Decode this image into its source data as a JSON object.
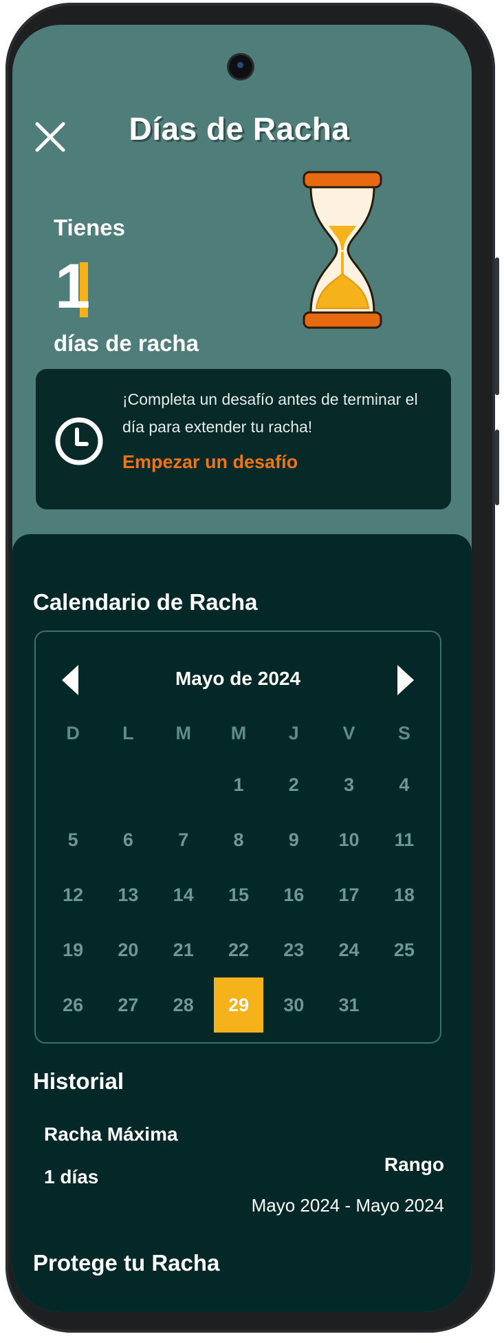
{
  "header": {
    "title": "Días de Racha"
  },
  "streak": {
    "prefix": "Tienes",
    "count": "1",
    "suffix": "días de racha"
  },
  "info_card": {
    "message": "¡Completa un desafío antes de terminar el día para extender tu racha!",
    "link": "Empezar un desafío"
  },
  "calendar": {
    "section_title": "Calendario de Racha",
    "month_label": "Mayo de 2024",
    "weekdays": [
      "D",
      "L",
      "M",
      "M",
      "J",
      "V",
      "S"
    ],
    "days": [
      "",
      "",
      "",
      "1",
      "2",
      "3",
      "4",
      "5",
      "6",
      "7",
      "8",
      "9",
      "10",
      "11",
      "12",
      "13",
      "14",
      "15",
      "16",
      "17",
      "18",
      "19",
      "20",
      "21",
      "22",
      "23",
      "24",
      "25",
      "26",
      "27",
      "28",
      "29",
      "30",
      "31",
      ""
    ],
    "today": "29"
  },
  "history": {
    "section_title": "Historial",
    "max_label": "Racha Máxima",
    "max_value": "1 días",
    "range_label": "Rango",
    "range_value": "Mayo 2024 - Mayo 2024"
  },
  "protect": {
    "section_title": "Protege tu Racha"
  },
  "colors": {
    "accent_orange": "#f07512",
    "highlight_yellow": "#f5b21a",
    "header_bg": "#4f7d79",
    "panel_bg": "#032827"
  }
}
